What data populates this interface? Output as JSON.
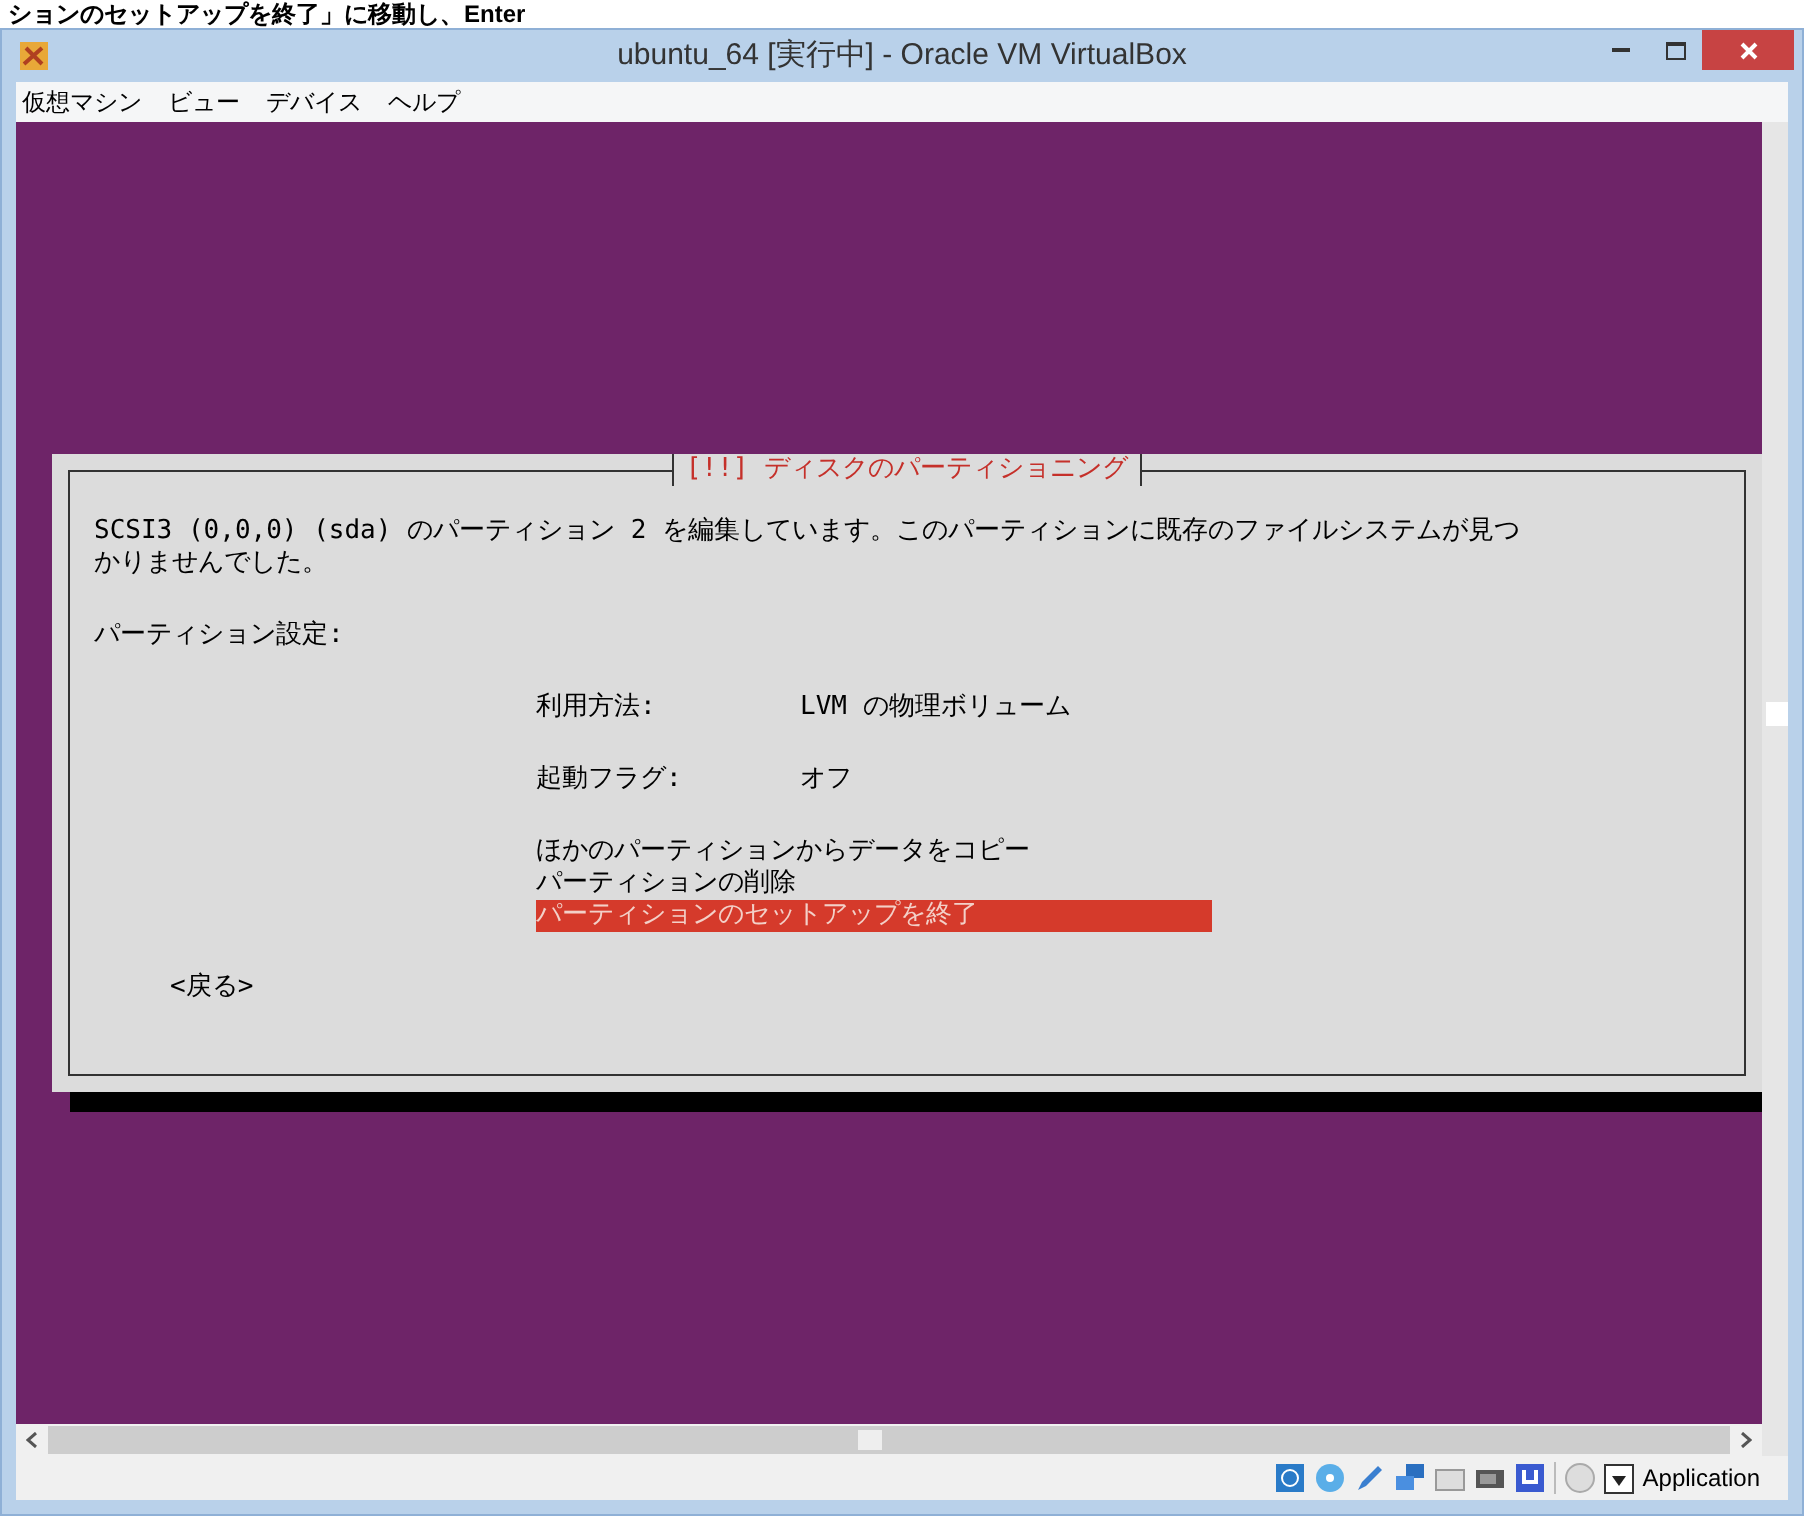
{
  "caption_above": "ションのセットアップを終了」に移動し、Enter",
  "window": {
    "title": "ubuntu_64 [実行中] - Oracle VM VirtualBox"
  },
  "menu": [
    "仮想マシン",
    "ビュー",
    "デバイス",
    "ヘルプ"
  ],
  "dialog": {
    "title": "[!!] ディスクのパーティショニング",
    "message": "SCSI3 (0,0,0) (sda) のパーティション 2 を編集しています。このパーティションに既存のファイルシステムが見つかりませんでした。",
    "section_label": "パーティション設定:",
    "settings": [
      {
        "label": "利用方法:",
        "value": "LVM の物理ボリューム"
      },
      {
        "label": "起動フラグ:",
        "value": "オフ"
      }
    ],
    "actions": [
      {
        "label": "ほかのパーティションからデータをコピー",
        "selected": false
      },
      {
        "label": "パーティションの削除",
        "selected": false
      },
      {
        "label": "パーティションのセットアップを終了",
        "selected": true
      }
    ],
    "back_button": "<戻る>"
  },
  "status_bar": {
    "label": "Application"
  }
}
